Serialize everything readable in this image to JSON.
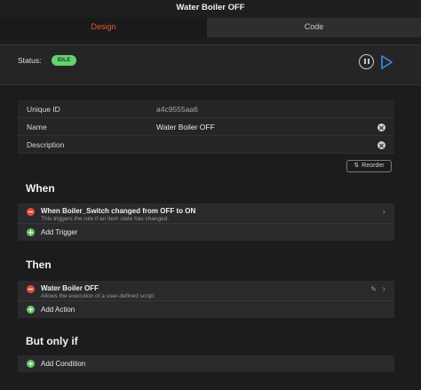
{
  "window": {
    "title": "Water Boiler OFF"
  },
  "tabs": [
    {
      "label": "Design",
      "active": true
    },
    {
      "label": "Code",
      "active": false
    }
  ],
  "status": {
    "label": "Status:",
    "badge": "IDLE",
    "badge_color": "#66d36e",
    "controls": [
      "pause-icon",
      "play-icon"
    ]
  },
  "info": {
    "uid_label": "Unique ID",
    "uid_value": "a4c9555aa6",
    "name_label": "Name",
    "name_value": "Water Boiler OFF",
    "desc_label": "Description",
    "desc_value": ""
  },
  "reorder": {
    "label": "Reorder",
    "icon": "reorder-icon"
  },
  "when": {
    "title": "When",
    "items": [
      {
        "title": "When Boiler_Switch changed from OFF to ON",
        "subtitle": "This triggers the rule if an item state has changed."
      }
    ],
    "add_label": "Add Trigger"
  },
  "then": {
    "title": "Then",
    "items": [
      {
        "title": "Water Boiler OFF",
        "subtitle": "Allows the execution of a user-defined script."
      }
    ],
    "add_label": "Add Action"
  },
  "condition": {
    "title": "But only if",
    "add_label": "Add Condition"
  },
  "colors": {
    "accent": "#e0563c",
    "remove": "#e4503e",
    "add": "#62c766",
    "play": "#3a8ee6"
  }
}
